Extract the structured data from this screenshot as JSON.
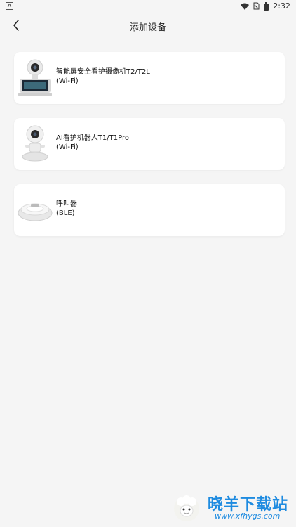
{
  "status_bar": {
    "notification_icon": "a-icon",
    "time": "2:32"
  },
  "header": {
    "title": "添加设备",
    "back_icon": "chevron-left-icon"
  },
  "devices": [
    {
      "name": "智能屏安全看护摄像机T2/T2L",
      "protocol": "(Wi-Fi)",
      "image": "camera-screen-device"
    },
    {
      "name": "AI看护机器人T1/T1Pro",
      "protocol": "(Wi-Fi)",
      "image": "robot-camera-device"
    },
    {
      "name": "呼叫器",
      "protocol": "(BLE)",
      "image": "pager-device"
    }
  ],
  "watermark": {
    "title": "晓羊下载站",
    "url": "www.xfhygs.com"
  }
}
